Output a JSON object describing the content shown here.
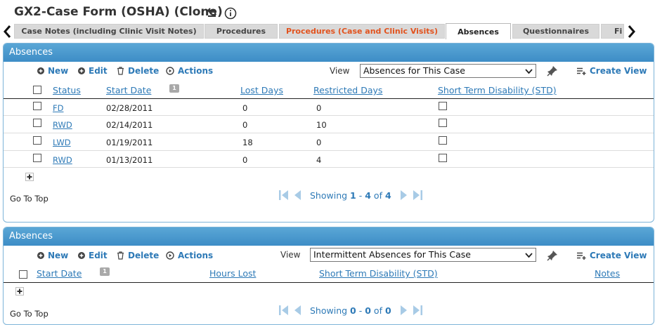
{
  "header": {
    "title": "GX2-Case Form (OSHA) (Clone)",
    "undo_icon": "undo-arrow-icon",
    "info_icon": "info-icon"
  },
  "tabs": [
    {
      "label": "Case Notes (including Clinic Visit Notes)",
      "state": "normal"
    },
    {
      "label": "Procedures",
      "state": "normal"
    },
    {
      "label": "Procedures (Case and Clinic Visits)",
      "state": "highlight"
    },
    {
      "label": "Absences",
      "state": "active"
    },
    {
      "label": "Questionnaires",
      "state": "normal"
    },
    {
      "label": "Fi",
      "state": "normal"
    }
  ],
  "colors": {
    "accent": "#2e7ab7",
    "panel_header": "#4a9ad0",
    "tab_highlight": "#e2531e"
  },
  "panel1": {
    "title": "Absences",
    "toolbar": {
      "new": "New",
      "edit": "Edit",
      "delete": "Delete",
      "actions": "Actions",
      "create_view": "Create View"
    },
    "view_label": "View",
    "view_selected": "Absences for This Case",
    "columns": {
      "status": "Status",
      "start_date": "Start Date",
      "sort_badge": "1",
      "lost_days": "Lost Days",
      "restricted_days": "Restricted Days",
      "std": "Short Term Disability (STD)"
    },
    "rows": [
      {
        "status": "FD",
        "start_date": "02/28/2011",
        "lost_days": "0",
        "restricted_days": "0",
        "std": false
      },
      {
        "status": "RWD",
        "start_date": "02/14/2011",
        "lost_days": "0",
        "restricted_days": "10",
        "std": false
      },
      {
        "status": "LWD",
        "start_date": "01/19/2011",
        "lost_days": "18",
        "restricted_days": "0",
        "std": false
      },
      {
        "status": "RWD",
        "start_date": "01/13/2011",
        "lost_days": "0",
        "restricted_days": "4",
        "std": false
      }
    ],
    "go_to_top": "Go To Top",
    "pager": {
      "showing": "Showing",
      "from": "1",
      "dash": "-",
      "to": "4",
      "of": "of",
      "total": "4"
    }
  },
  "panel2": {
    "title": "Absences",
    "toolbar": {
      "new": "New",
      "edit": "Edit",
      "delete": "Delete",
      "actions": "Actions",
      "create_view": "Create View"
    },
    "view_label": "View",
    "view_selected": "Intermittent Absences for This Case",
    "columns": {
      "start_date": "Start Date",
      "sort_badge": "1",
      "hours_lost": "Hours Lost",
      "std": "Short Term Disability (STD)",
      "notes": "Notes"
    },
    "go_to_top": "Go To Top",
    "pager": {
      "showing": "Showing",
      "from": "0",
      "dash": "-",
      "to": "0",
      "of": "of",
      "total": "0"
    }
  }
}
